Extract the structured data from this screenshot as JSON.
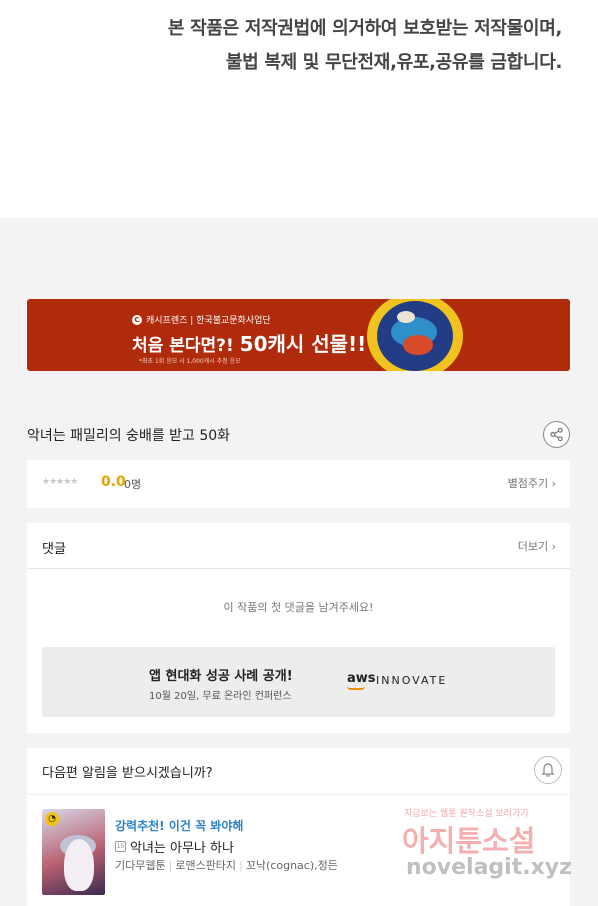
{
  "notice": {
    "line1": "본 작품은 저작권법에 의거하여 보호받는 저작물이며,",
    "line2": "불법 복제 및 무단전재,유포,공유를 금합니다."
  },
  "banner": {
    "brand": "캐시프렌즈 | 한국불교문화사업단",
    "headline_prefix": "처음 본다면?!",
    "headline_main": "50캐시 선물!!",
    "fine_print": "*최초 1회 응모 시 1,000캐시 추첨 응모"
  },
  "episode": {
    "title": "악녀는 패밀리의 숭배를 받고 50화",
    "share_icon": "share-icon"
  },
  "rating": {
    "stars": "★★★★★",
    "score": "0.0",
    "count": "0명",
    "rate_label": "별점주기 ›"
  },
  "comments": {
    "label": "댓글",
    "more_label": "더보기 ›",
    "empty_message": "이 작품의 첫 댓글을 남겨주세요!"
  },
  "ad": {
    "title": "앱 현대화 성공 사례 공개!",
    "subtitle": "10월 20일, 무료 온라인 컨퍼런스",
    "brand": "aws",
    "brand_sub": "INNOVATE"
  },
  "alarm": {
    "question": "다음편 알림을 받으시겠습니까?",
    "bell_icon": "bell-icon"
  },
  "recommendation": {
    "tag": "강력추천! 이건 꼭 봐야해",
    "age": "15",
    "title": "악녀는 아무나 하나",
    "meta": [
      "기다무웹툰",
      "로맨스판타지",
      "꼬낙(cognac),정든"
    ]
  },
  "watermark": {
    "top": "지금보는 웹툰 원작소설 보러가기",
    "main": "아지툰소설",
    "url": "novelagit.xyz"
  },
  "colors": {
    "banner_bg": "#b02a0c",
    "rating_score": "#e6a500",
    "recommend_tag": "#2c82c9"
  }
}
